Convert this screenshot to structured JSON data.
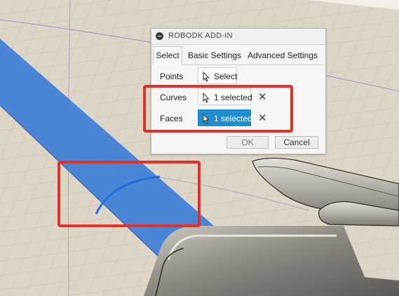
{
  "dialog": {
    "title": "ROBODK ADD-IN",
    "tabs": [
      {
        "label": "Select",
        "active": true
      },
      {
        "label": "Basic Settings",
        "active": false
      },
      {
        "label": "Advanced Settings",
        "active": false
      }
    ],
    "rows": {
      "points": {
        "label": "Points",
        "button": "Select"
      },
      "curves": {
        "label": "Curves",
        "button": "1 selected"
      },
      "faces": {
        "label": "Faces",
        "button": "1 selected"
      }
    },
    "ok_label": "OK",
    "cancel_label": "Cancel",
    "clear_symbol": "✕"
  },
  "colors": {
    "viewport_bg": "#ddd5c6",
    "selected_face": "#3d7fd6",
    "selected_curve": "#1e6fe0",
    "highlight_box": "#e5302a",
    "active_button": "#1e8ed1"
  },
  "icons": [
    "collapse-icon",
    "cursor-icon",
    "close-icon"
  ]
}
